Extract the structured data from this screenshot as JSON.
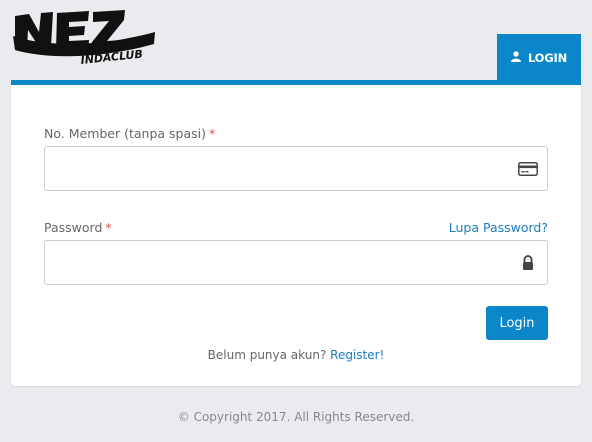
{
  "logo": {
    "brand": "NEZ",
    "tagline": "INDACLUB"
  },
  "tab": {
    "label": "LOGIN",
    "icon": "user-icon"
  },
  "form": {
    "member_label": "No. Member (tanpa spasi)",
    "member_value": "",
    "member_icon": "credit-card-icon",
    "password_label": "Password",
    "password_value": "",
    "password_icon": "lock-icon",
    "required_mark": "*",
    "forgot_link": "Lupa Password?",
    "submit_label": "Login",
    "register_prompt": "Belum punya akun?",
    "register_link": "Register!"
  },
  "footer": {
    "copyright": "© Copyright 2017. All Rights Reserved."
  },
  "colors": {
    "accent": "#0b86c8",
    "link": "#1b7cc0",
    "required": "#d9534f",
    "background": "#e9ebee"
  }
}
